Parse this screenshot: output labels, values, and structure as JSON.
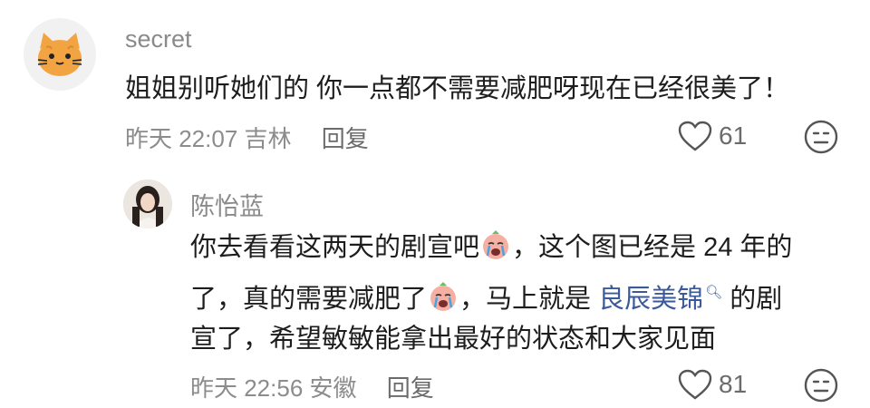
{
  "comment1": {
    "username": "secret",
    "text": "姐姐别听她们的 你一点都不需要减肥呀现在已经很美了！",
    "time": "昨天 22:07",
    "location": "吉林",
    "reply_label": "回复",
    "likes": "61"
  },
  "comment2": {
    "username": "陈怡蓝",
    "line1a": "你去看看这两天的剧宣吧",
    "line1b": "，这个图已经是 24 年的",
    "line2a": "了，真的需要减肥了",
    "line2b": "，马上就是 ",
    "tag": "良辰美锦",
    "line2c": " 的剧",
    "line3": "宣了，希望敏敏能拿出最好的状态和大家见面",
    "time": "昨天 22:56",
    "location": "安徽",
    "reply_label": "回复",
    "likes": "81"
  },
  "icons": {
    "like": "heart-outline-icon",
    "dislike": "meh-face-icon",
    "emoji": "crying-face-emoji",
    "search": "search-icon"
  }
}
